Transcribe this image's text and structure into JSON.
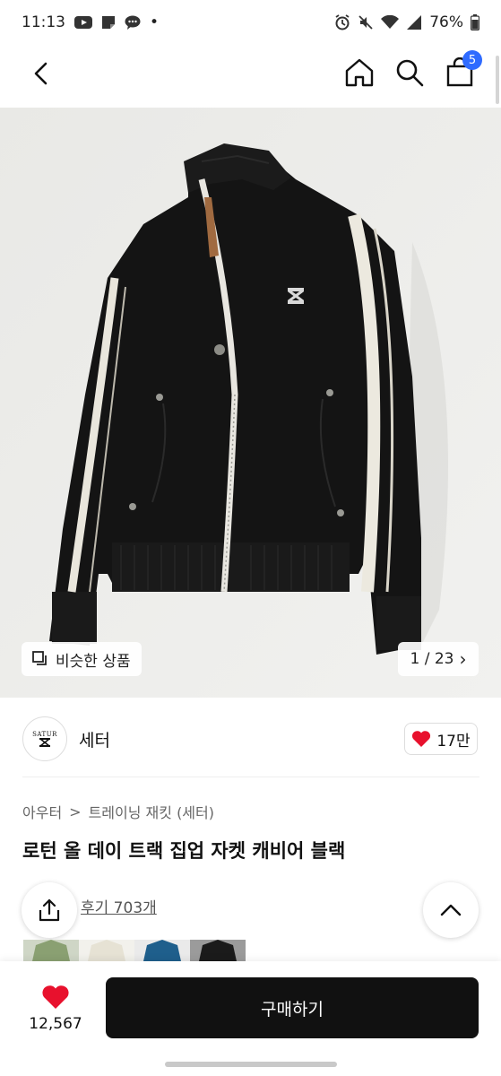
{
  "status_bar": {
    "time": "11:13",
    "battery": "76%",
    "dot": "•"
  },
  "header": {
    "cart_badge": "5"
  },
  "gallery": {
    "similar_label": "비슷한 상품",
    "page_counter": "1 / 23",
    "chevron": "›"
  },
  "shop": {
    "avatar_text": "SATUR",
    "name": "세터",
    "likes": "17만"
  },
  "breadcrumb": {
    "category": "아우터",
    "separator": ">",
    "subcategory": "트레이닝 재킷 (세터)"
  },
  "product": {
    "title": "로턴 올 데이 트랙 집업 자켓 캐비어 블랙"
  },
  "reviews": {
    "label": "후기 703개"
  },
  "color_options": [
    {
      "name": "green",
      "color": "#8aa072"
    },
    {
      "name": "cream",
      "color": "#e6e2d4"
    },
    {
      "name": "blue",
      "color": "#1f5f8c"
    },
    {
      "name": "black",
      "color": "#1b1b1b"
    }
  ],
  "bottom_bar": {
    "wish_count": "12,567",
    "buy_label": "구매하기"
  },
  "colors": {
    "accent_blue": "#2f6bff",
    "heart_red": "#e8112d",
    "buy_button": "#111111"
  }
}
